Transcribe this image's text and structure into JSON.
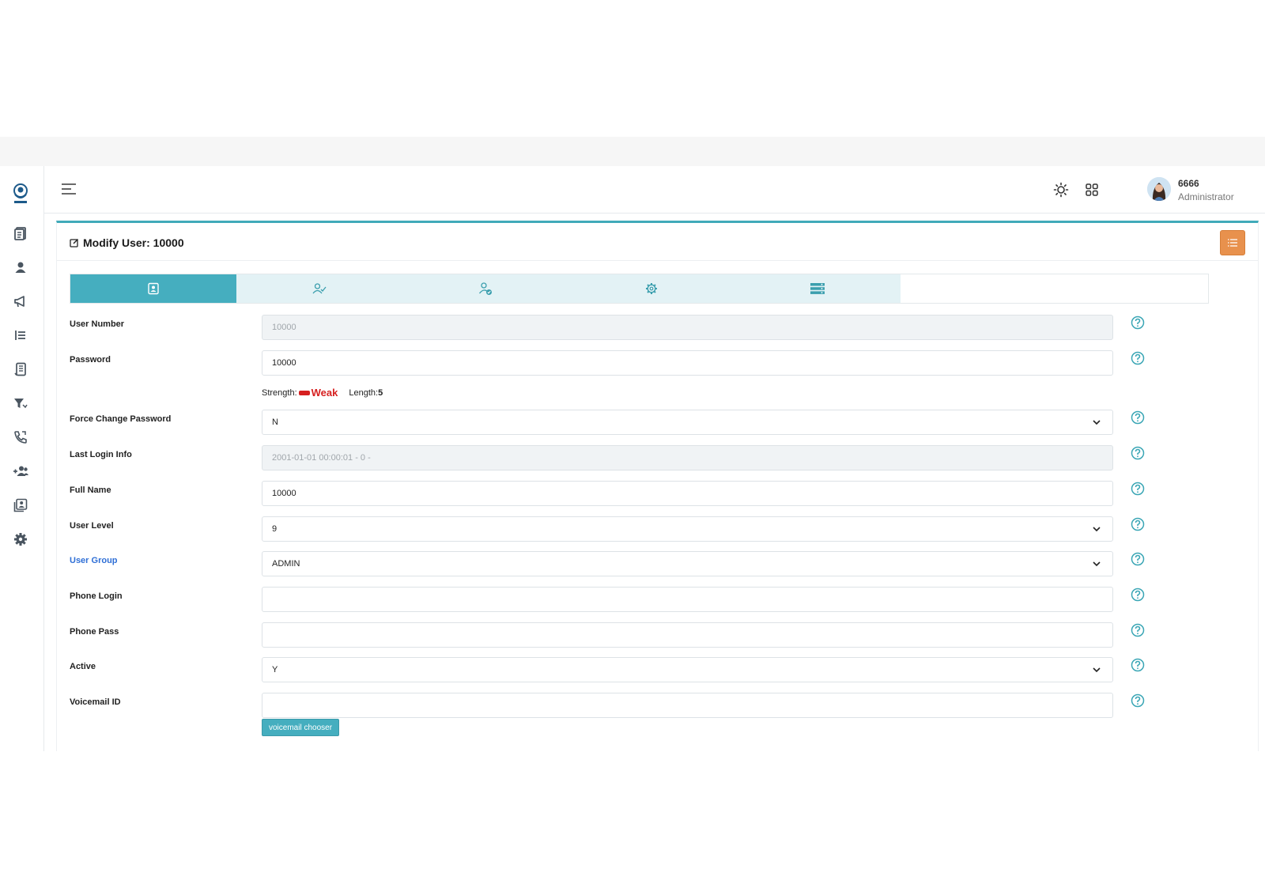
{
  "topbar": {
    "user_name": "6666",
    "user_role": "Administrator"
  },
  "page": {
    "title": "Modify User: 10000"
  },
  "sidebar": {
    "items": [
      "reports-icon",
      "user-icon",
      "megaphone-icon",
      "list-icon",
      "script-icon",
      "filter-icon",
      "phone-icon",
      "add-users-icon",
      "gallery-icon",
      "settings-icon"
    ]
  },
  "tabs": [
    "user-info-icon",
    "user-check-icon",
    "user-verified-icon",
    "gear-icon",
    "server-icon"
  ],
  "form": {
    "user_number": {
      "label": "User Number",
      "value": "10000"
    },
    "password": {
      "label": "Password",
      "value": "10000"
    },
    "strength": {
      "label": "Strength:",
      "value": "Weak",
      "length_label": "Length:",
      "length_value": "5"
    },
    "force_change_password": {
      "label": "Force Change Password",
      "value": "N"
    },
    "last_login_info": {
      "label": "Last Login Info",
      "value": "2001-01-01 00:00:01 - 0 -"
    },
    "full_name": {
      "label": "Full Name",
      "value": "10000"
    },
    "user_level": {
      "label": "User Level",
      "value": "9"
    },
    "user_group": {
      "label": "User Group",
      "value": "ADMIN"
    },
    "phone_login": {
      "label": "Phone Login",
      "value": ""
    },
    "phone_pass": {
      "label": "Phone Pass",
      "value": ""
    },
    "active": {
      "label": "Active",
      "value": "Y"
    },
    "voicemail_id": {
      "label": "Voicemail ID",
      "value": ""
    },
    "voicemail_chooser_label": "voicemail chooser"
  },
  "colors": {
    "accent": "#45aebf",
    "orange_button": "#e8914d",
    "weak": "#d62020",
    "link": "#2f6fd6"
  }
}
